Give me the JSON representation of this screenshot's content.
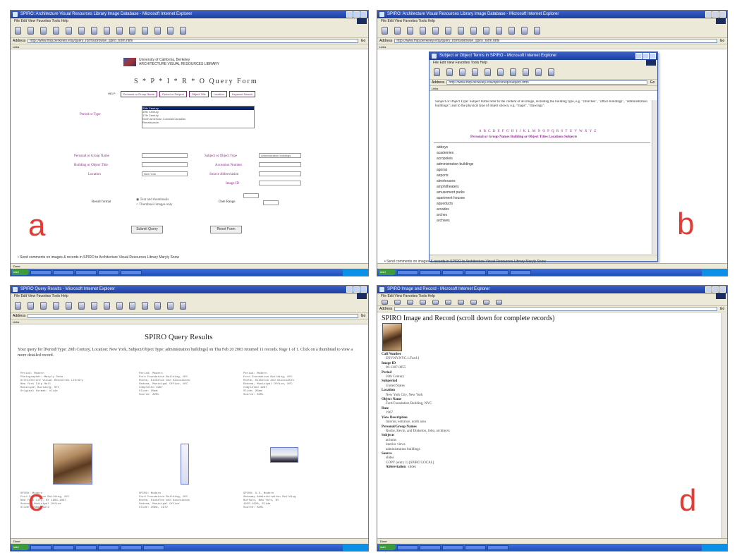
{
  "panels": {
    "a": {
      "letter": "a",
      "window_title": "SPIRO: Architecture Visual Resources Library Image Database - Microsoft Internet Explorer",
      "menu": "File  Edit  View  Favorites  Tools  Help",
      "address": "http://www.mip.berkeley.edu/query_forms/browse_spiro_form.html",
      "links": "Links",
      "header_line1": "University of California, Berkeley",
      "header_line2": "ARCHITECTURE VISUAL RESOURCES LIBRARY",
      "query_title": "S * P * I * R * O Query Form",
      "tabs_label": "HELP:",
      "tabs": [
        "Personal or Group Name",
        "Period or Subject",
        "Object Title",
        "Location",
        "Keyword Search"
      ],
      "period_label": "Period or Type",
      "period_options": [
        "20th Century",
        "19th Century",
        "17th Century",
        "North American Colonial/Canadian",
        "Renaissance"
      ],
      "fields_left": [
        "Personal or Group Name",
        "Building or Object Title",
        "Location"
      ],
      "location_value": "New York",
      "fields_right": [
        "Subject or Object Type",
        "Accession Number",
        "Source Abbreviation",
        "Image ID"
      ],
      "subject_value": "Administration buildings",
      "result_format_label": "Result format",
      "result_option_1": "Text and thumbnails",
      "result_option_2": "Thumbnail images only",
      "date_range_label": "Date Range",
      "submit_label": "Submit Query",
      "reset_label": "Reset Form",
      "bottom_note": "Send comments on images & records in SPIRO to Architecture Visual Resources Library Maryly Snow",
      "status": "Done"
    },
    "b": {
      "letter": "b",
      "popup_title": "Subject or Object Terms in SPIRO - Microsoft Internet Explorer",
      "popup_menu": "File  Edit  View  Favorites  Tools  Help",
      "popup_address": "http://www.mip.berkeley.edu/spiro/help/subject.html",
      "intro": "Subject or Object Type: Subject terms refer to the content of an image, including the building type, e.g. \"churches\", \"office buildings\", \"administration buildings\"; and to the physical type of object shown, e.g. \"maps\", \"drawings\".",
      "alphabet": "A B C D E F G H I J K L M N O P Q R S T U V W X Y Z",
      "help_links": "Personal or Group Names  Building or Object Titles  Locations  Subjects",
      "subjects": [
        "abbeys",
        "academies",
        "acropoleis",
        "administration buildings",
        "agoras",
        "airports",
        "almshouses",
        "amphitheaters",
        "amusement parks",
        "apartment houses",
        "aqueducts",
        "arcades",
        "arches",
        "archives"
      ],
      "bottom_note": "Send comments on images & records in SPIRO to Architecture Visual Resources Library Maryly Snow"
    },
    "c": {
      "letter": "c",
      "window_title": "SPIRO Query Results - Microsoft Internet Explorer",
      "results_title": "SPIRO Query Results",
      "results_para": "Your query for [Period/Type: 20th Century, Location: New York, Subject/Object Type: administration buildings] on Thu Feb 20 2003 returned 11 records. Page 1 of 1. Click on a thumbnail to view a more detailed record.",
      "col1_top": [
        "Period: Modern",
        "Photographer: Maryly Snow",
        "Architecture Visual Resources Library",
        "New York City Hall",
        "Municipal Building, NYC",
        "Original format: slide"
      ],
      "col2_top": [
        "Period: Modern",
        "Ford Foundation Building, NYC",
        "Roche, Dinkeloo and Associates",
        "Sedona, Municipal Office, NYC",
        "Completed 1967",
        "Slide: 35mm",
        "Source: AVRL"
      ],
      "col3_top": [
        "Period: Modern",
        "Ford Foundation Building, NYC",
        "Roche, Dinkeloo and Associates",
        "Sedona, Municipal Office, NYC",
        "Completed 1967",
        "Slide: 35mm",
        "Source: AVRL"
      ],
      "col1_bottom": [
        "SPIRO: Modern",
        "Ford Foundation Building, NYC",
        "New York City, NY 1963-1967",
        "Sedona, Municipal Office",
        "Slide: 35mm, 1972"
      ],
      "col2_bottom": [
        "SPIRO: Modern",
        "Ford Foundation Building, NYC",
        "Roche, Dinkeloo and Associates",
        "Sedona, Municipal Office",
        "Slide: 35mm, 1972"
      ],
      "col3_bottom": [
        "SPIRO: U.S. Modern",
        "Gateway Administration Building",
        "Buffalo, New York, NY",
        "1925-1928, Slide",
        "Source: AVRL"
      ],
      "status": "Done"
    },
    "d": {
      "letter": "d",
      "window_title": "SPIRO Image and Record - Microsoft Internet Explorer",
      "record_title": "SPIRO Image and Record (scroll down for complete records)",
      "fields": [
        {
          "label": "Call Number",
          "value": "ENV.NY.NYC.1.Ford.1"
        },
        {
          "label": "Image ID",
          "value": "09-1307-0055"
        },
        {
          "label": "Period",
          "value": "20th Century"
        },
        {
          "label": "Subperiod",
          "value": "United States"
        },
        {
          "label": "Location",
          "value": "New York City, New York"
        },
        {
          "label": "Object Name",
          "value": "Ford Foundation Building, NYC"
        },
        {
          "label": "Date",
          "value": "1967"
        },
        {
          "label": "View Description",
          "value": "Interior, entrance, north area"
        },
        {
          "label": "Personal/Group Names",
          "value": "Roche, Kevin, and Dinkeloo, John, architects"
        },
        {
          "label": "Subjects",
          "value": "atriums\ninterior views\nadministration buildings"
        },
        {
          "label": "Source",
          "value": "slides\nCOPY (entry 1) [SPIRO LOCAL]"
        },
        {
          "label": "Abbreviation",
          "value": "slides"
        }
      ],
      "status": "Done"
    }
  },
  "colors": {
    "purple": "#8a2a8a",
    "letter": "#e23a34",
    "titlebar": "#1d3f9e"
  }
}
